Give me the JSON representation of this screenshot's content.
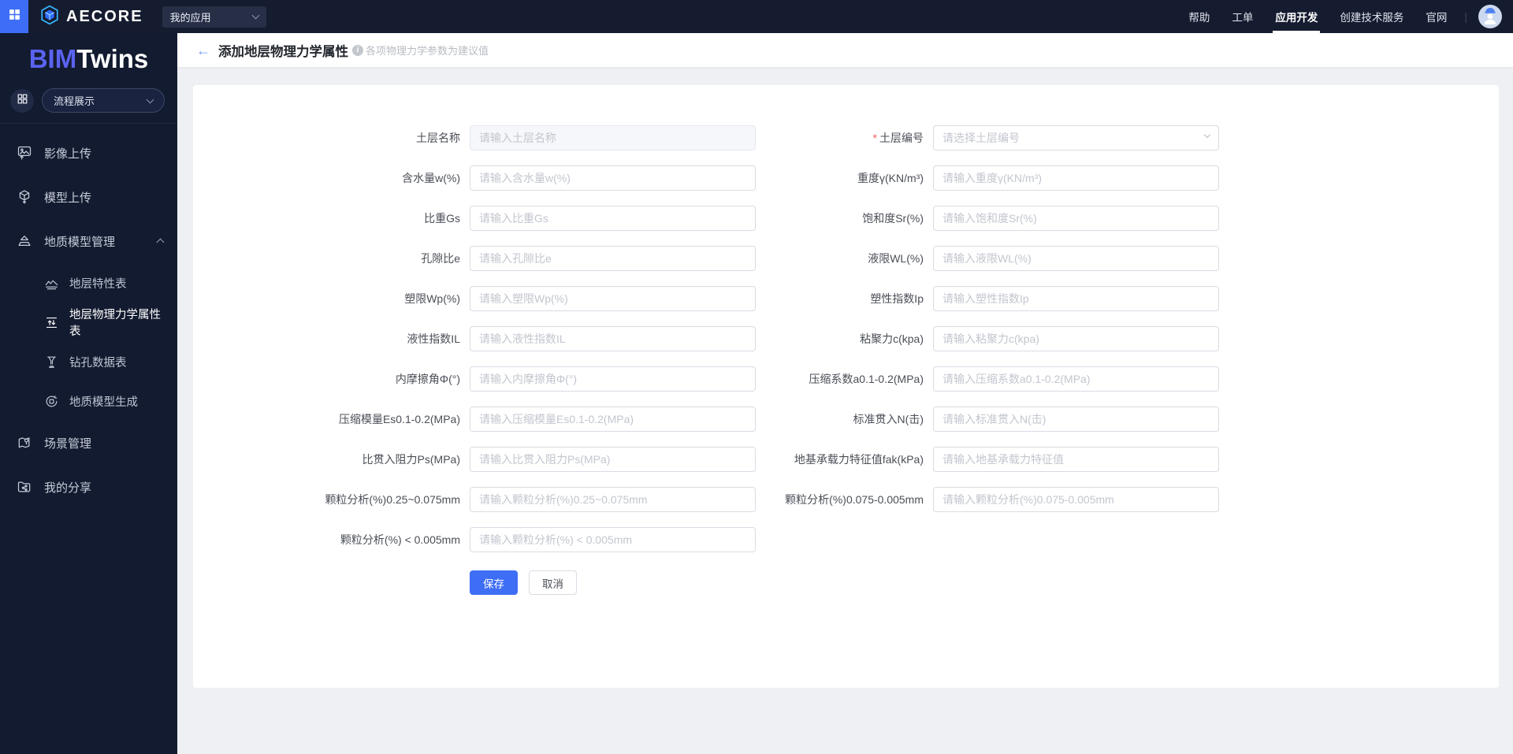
{
  "topbar": {
    "brand": "AECORE",
    "app_select": {
      "value": "我的应用"
    },
    "menu": [
      {
        "label": "帮助",
        "active": false
      },
      {
        "label": "工单",
        "active": false
      },
      {
        "label": "应用开发",
        "active": true
      },
      {
        "label": "创建技术服务",
        "active": false
      },
      {
        "label": "官网",
        "active": false
      }
    ]
  },
  "sidebar": {
    "logo": {
      "bim": "BIM",
      "twins": "Twins"
    },
    "flow_select": {
      "value": "流程展示"
    },
    "items": [
      {
        "label": "影像上传",
        "icon": "image-upload",
        "level": 1
      },
      {
        "label": "模型上传",
        "icon": "model-upload",
        "level": 1
      },
      {
        "label": "地质模型管理",
        "icon": "geo-model-manage",
        "level": 1,
        "expanded": true
      },
      {
        "label": "地层特性表",
        "icon": "strata-table",
        "level": 2
      },
      {
        "label": "地层物理力学属性表",
        "icon": "phys-props-table",
        "level": 2,
        "active": true
      },
      {
        "label": "钻孔数据表",
        "icon": "borehole-table",
        "level": 2
      },
      {
        "label": "地质模型生成",
        "icon": "model-generate",
        "level": 2
      },
      {
        "label": "场景管理",
        "icon": "scene-manage",
        "level": 1
      },
      {
        "label": "我的分享",
        "icon": "my-share",
        "level": 1
      }
    ]
  },
  "page": {
    "title": "添加地层物理力学属性",
    "note": "各项物理力学参数为建议值"
  },
  "form": {
    "rows": [
      {
        "left": {
          "label": "土层名称",
          "placeholder": "请输入土层名称",
          "disabled": true
        },
        "right": {
          "label": "土层编号",
          "placeholder": "请选择土层编号",
          "required": true,
          "type": "select"
        }
      },
      {
        "left": {
          "label": "含水量w(%)",
          "placeholder": "请输入含水量w(%)"
        },
        "right": {
          "label": "重度γ(KN/m³)",
          "placeholder": "请输入重度γ(KN/m³)"
        }
      },
      {
        "left": {
          "label": "比重Gs",
          "placeholder": "请输入比重Gs"
        },
        "right": {
          "label": "饱和度Sr(%)",
          "placeholder": "请输入饱和度Sr(%)"
        }
      },
      {
        "left": {
          "label": "孔隙比e",
          "placeholder": "请输入孔隙比e"
        },
        "right": {
          "label": "液限WL(%)",
          "placeholder": "请输入液限WL(%)"
        }
      },
      {
        "left": {
          "label": "塑限Wp(%)",
          "placeholder": "请输入塑限Wp(%)"
        },
        "right": {
          "label": "塑性指数Ip",
          "placeholder": "请输入塑性指数Ip"
        }
      },
      {
        "left": {
          "label": "液性指数IL",
          "placeholder": "请输入液性指数IL"
        },
        "right": {
          "label": "粘聚力c(kpa)",
          "placeholder": "请输入粘聚力c(kpa)"
        }
      },
      {
        "left": {
          "label": "内摩擦角Φ(°)",
          "placeholder": "请输入内摩擦角Φ(°)"
        },
        "right": {
          "label": "压缩系数a0.1-0.2(MPa)",
          "placeholder": "请输入压缩系数a0.1-0.2(MPa)"
        }
      },
      {
        "left": {
          "label": "压缩模量Es0.1-0.2(MPa)",
          "placeholder": "请输入压缩模量Es0.1-0.2(MPa)"
        },
        "right": {
          "label": "标准贯入N(击)",
          "placeholder": "请输入标准贯入N(击)"
        }
      },
      {
        "left": {
          "label": "比贯入阻力Ps(MPa)",
          "placeholder": "请输入比贯入阻力Ps(MPa)"
        },
        "right": {
          "label": "地基承载力特征值fak(kPa)",
          "placeholder": "请输入地基承载力特征值"
        }
      },
      {
        "left": {
          "label": "颗粒分析(%)0.25~0.075mm",
          "placeholder": "请输入颗粒分析(%)0.25~0.075mm"
        },
        "right": {
          "label": "颗粒分析(%)0.075-0.005mm",
          "placeholder": "请输入颗粒分析(%)0.075-0.005mm"
        }
      },
      {
        "left": {
          "label": "颗粒分析(%) < 0.005mm",
          "placeholder": "请输入颗粒分析(%) < 0.005mm"
        },
        "right": null
      }
    ],
    "save_label": "保存",
    "cancel_label": "取消"
  },
  "colors": {
    "accent": "#3e6ef5",
    "topbar_bg": "#161c30",
    "sidebar_bg": "#131b30",
    "logo_blue": "#5b63f1",
    "required_red": "#f25a5a",
    "content_bg": "#eef0f4"
  }
}
